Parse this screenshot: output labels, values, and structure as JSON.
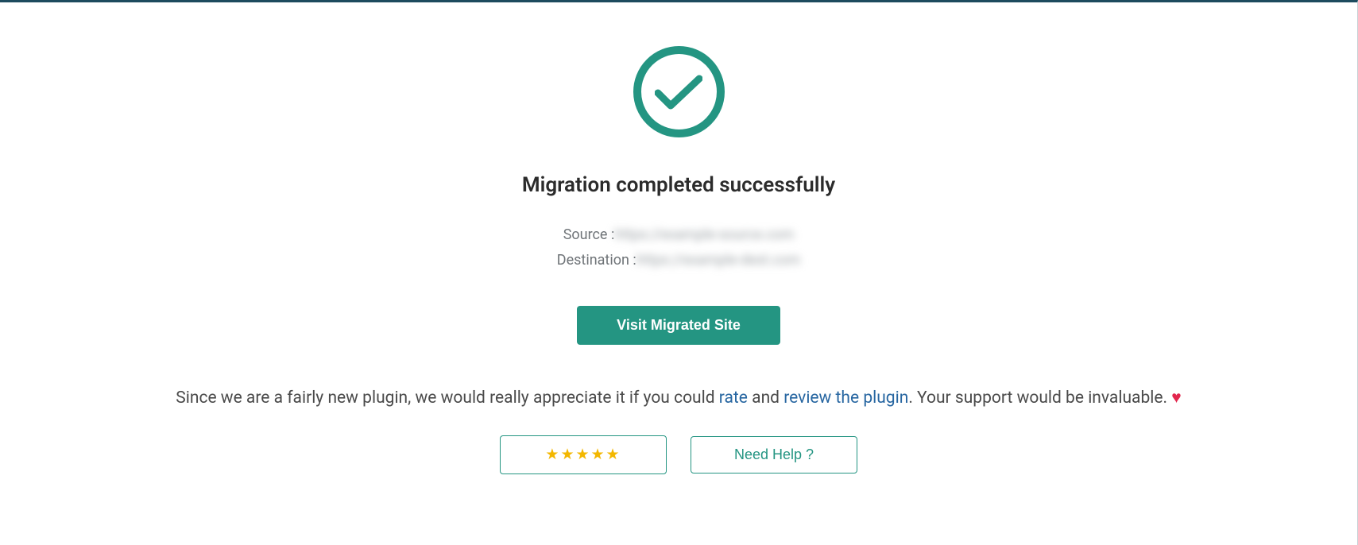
{
  "heading": "Migration completed successfully",
  "source": {
    "label": "Source :",
    "value": "https://example-source.com"
  },
  "destination": {
    "label": "Destination :",
    "value": "https://example-dest.com"
  },
  "visit_button_label": "Visit Migrated Site",
  "appreciation": {
    "part1": "Since we are a fairly new plugin, we would really appreciate it if you could ",
    "link1": "rate",
    "part2": " and ",
    "link2": "review the plugin",
    "part3": ". Your support would be invaluable. ",
    "heart": "♥"
  },
  "rate_button_stars": "★★★★★",
  "help_button_label": "Need Help ?"
}
